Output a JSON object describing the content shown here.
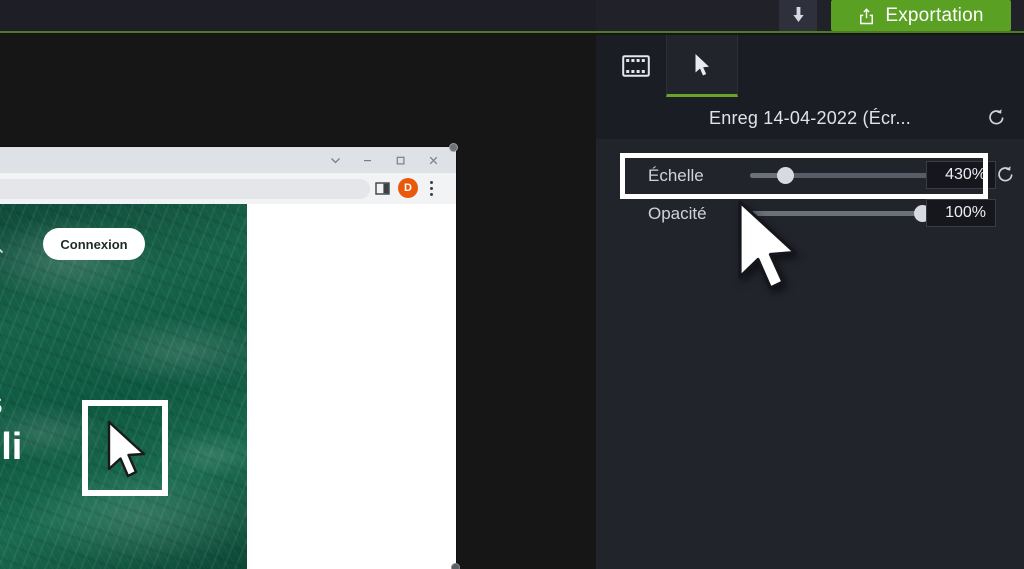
{
  "toolbar": {
    "download_icon": "download-icon",
    "export_label": "Exportation",
    "export_icon": "share-upload-icon",
    "accent_green": "#5aa023"
  },
  "panel": {
    "tabs": [
      {
        "name": "media-tab",
        "icon": "film-strip-icon",
        "active": false
      },
      {
        "name": "cursor-tab",
        "icon": "cursor-arrow-icon",
        "active": true
      }
    ],
    "clip_title": "Enreg 14-04-2022 (Écr...",
    "clip_reset_icon": "reset-icon",
    "properties": [
      {
        "label": "Échelle",
        "value": "430%",
        "percent": 18,
        "highlighted": true,
        "reset_icon": "reset-icon"
      },
      {
        "label": "Opacité",
        "value": "100%",
        "percent": 88,
        "highlighted": false
      }
    ],
    "cursor_overlay_icon": "mouse-pointer-icon",
    "background_color": "#22242c",
    "tabbar_color": "#1b1d24"
  },
  "preview": {
    "canvas_color": "#161616",
    "browser": {
      "window_controls": [
        {
          "name": "chevron-down",
          "icon": "chevron-down-icon"
        },
        {
          "name": "minimize",
          "icon": "minimize-icon"
        },
        {
          "name": "maximize",
          "icon": "maximize-icon"
        },
        {
          "name": "close",
          "icon": "close-icon"
        }
      ],
      "address_bar_value": "",
      "address_bar_placeholder": "",
      "sidebar_panel_icon": "side-panel-icon",
      "avatar_initial": "D",
      "avatar_color": "#e8590c",
      "menu_icon": "three-dot-menu-icon"
    },
    "page": {
      "search_icon": "search-icon",
      "connexion_label": "Connexion",
      "headline_fragment_1": "s",
      "headline_fragment_2": "oli",
      "hero_color": "#14593f",
      "selection_cursor_icon": "mouse-pointer-icon"
    }
  }
}
